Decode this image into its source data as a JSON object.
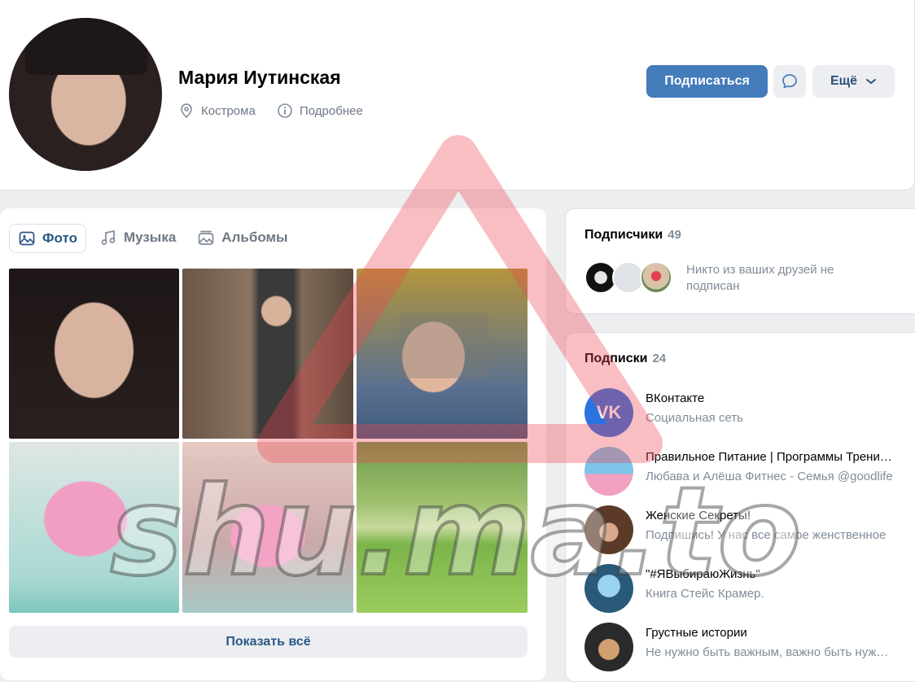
{
  "profile": {
    "name": "Мария Иутинская",
    "city": "Кострома",
    "details": "Подробнее",
    "subscribe": "Подписаться",
    "more": "Ещё"
  },
  "media_tabs": [
    {
      "label": "Фото",
      "icon": "image-icon",
      "active": true
    },
    {
      "label": "Музыка",
      "icon": "music-icon",
      "active": false
    },
    {
      "label": "Альбомы",
      "icon": "album-icon",
      "active": false
    }
  ],
  "photos": {
    "show_all": "Показать всё"
  },
  "followers": {
    "title": "Подписчики",
    "count": "49",
    "note": "Никто из ваших друзей не подписан"
  },
  "subscriptions": {
    "title": "Подписки",
    "count": "24",
    "items": [
      {
        "title": "ВКонтакте",
        "desc": "Социальная сеть"
      },
      {
        "title": "Правильное Питание | Программы Тренировок",
        "desc": "Любава и Алёша Фитнес - Семья @goodlife"
      },
      {
        "title": "Женские Секреты!",
        "desc": "Подпишись! У нас все самое женственное"
      },
      {
        "title": "\"#ЯВыбираюЖизнь\"",
        "desc": "Книга Стейс Крамер."
      },
      {
        "title": "Грустные истории",
        "desc": "Не нужно быть важным, важно быть нужным"
      }
    ]
  },
  "watermark": {
    "text": "shu.ma.to"
  },
  "colors": {
    "accent": "#447bba",
    "link": "#2a5885",
    "muted": "#818c99",
    "bg": "#edeef0"
  }
}
